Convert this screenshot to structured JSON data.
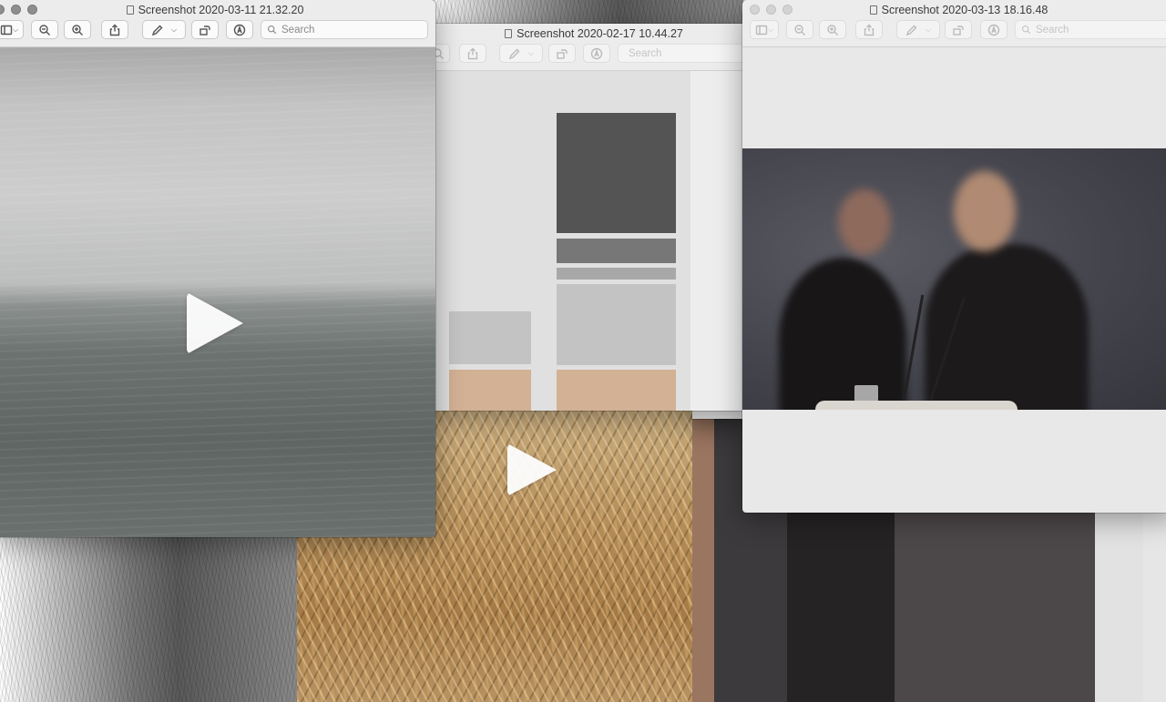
{
  "windows": {
    "sea": {
      "title": "Screenshot 2020-03-11 21.32.20"
    },
    "palette": {
      "title": "Screenshot 2020-02-17 10.44.27"
    },
    "press": {
      "title": "Screenshot 2020-03-13 18.16.48"
    }
  },
  "toolbar": {
    "search_placeholder": "Search"
  },
  "colors": {
    "sea_sky": "#c9c9c9",
    "sea_water": "#6b716e",
    "palette_dark": "#545454",
    "palette_mid": "#777777",
    "palette_light": "#a8a8a8",
    "palette_pale": "#c3c3c3",
    "palette_tan": "#d3b194",
    "press_background": "#4a4a52"
  },
  "icons": [
    "sidebar-icon",
    "zoom-out-icon",
    "zoom-in-icon",
    "share-icon",
    "markup-pen-icon",
    "rotate-icon",
    "annotate-icon",
    "search-icon",
    "play-icon"
  ]
}
